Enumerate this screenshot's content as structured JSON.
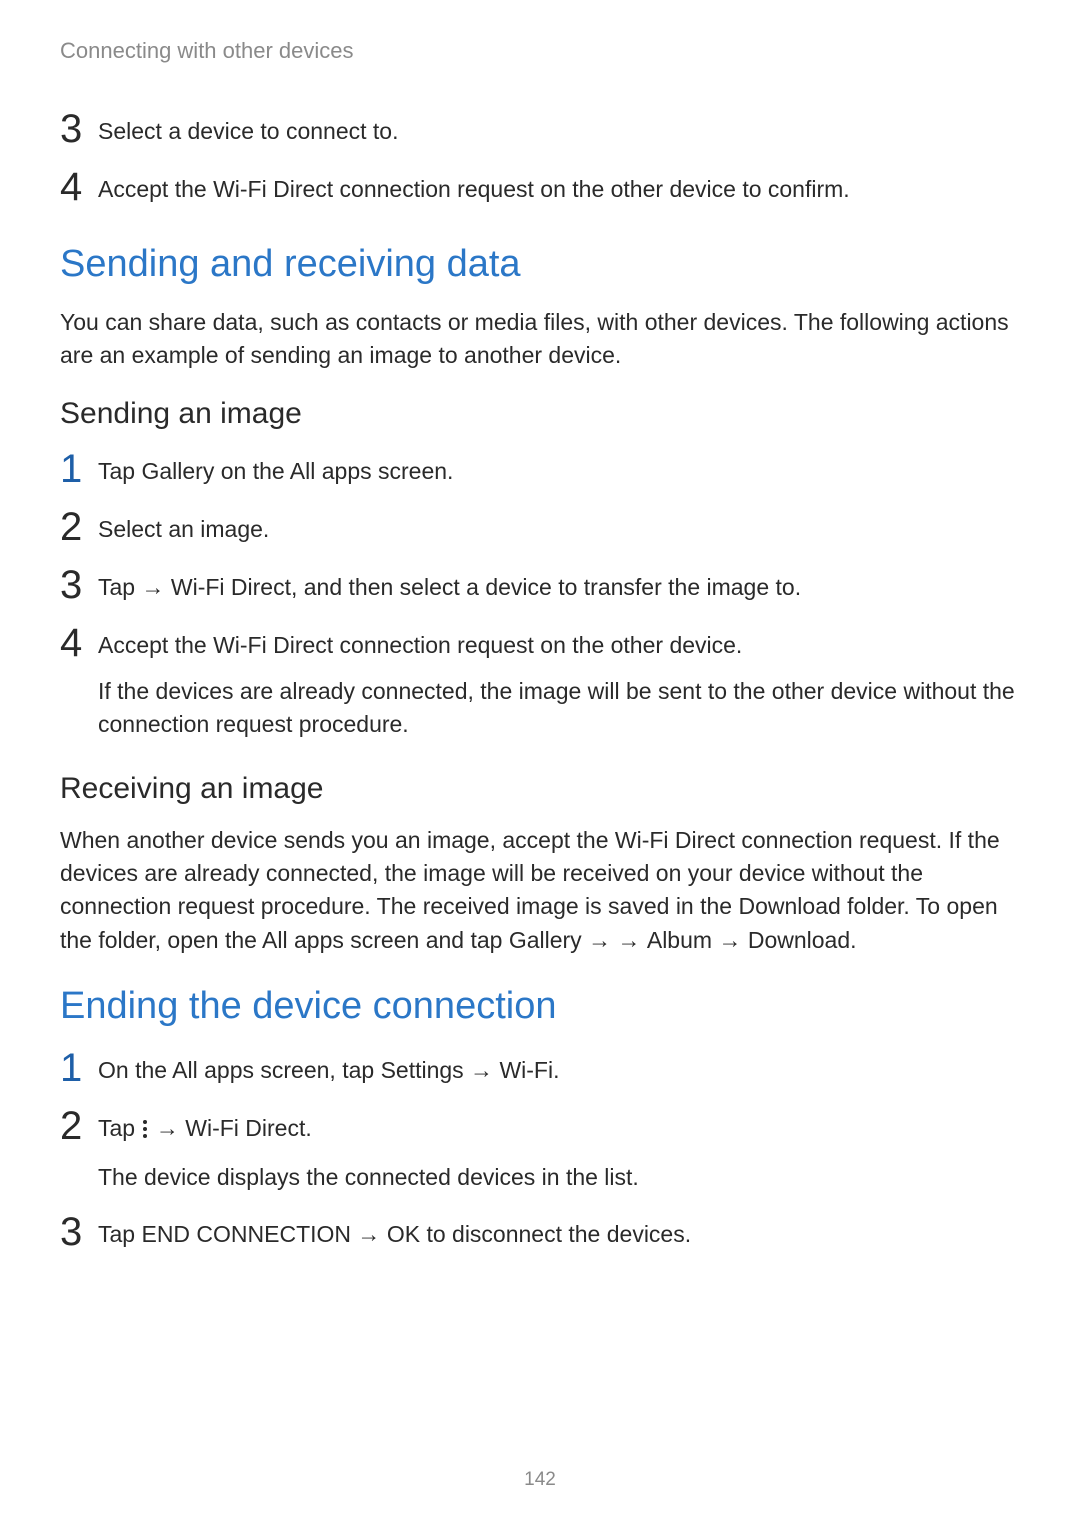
{
  "header": {
    "breadcrumb": "Connecting with other devices"
  },
  "intro_steps": {
    "s3": {
      "num": "3",
      "text": "Select a device to connect to."
    },
    "s4": {
      "num": "4",
      "text": "Accept the Wi-Fi Direct connection request on the other device to confirm."
    }
  },
  "section1": {
    "heading": "Sending and receiving data",
    "intro": "You can share data, such as contacts or media files, with other devices. The following actions are an example of sending an image to another device.",
    "sub1": {
      "heading": "Sending an image",
      "s1": {
        "num": "1",
        "pre": "Tap ",
        "bold": "Gallery",
        "post": " on the All apps screen."
      },
      "s2": {
        "num": "2",
        "text": "Select an image."
      },
      "s3": {
        "num": "3",
        "pre": "Tap ",
        "arrow1": " → ",
        "bold": "Wi-Fi Direct",
        "post": ", and then select a device to transfer the image to."
      },
      "s4": {
        "num": "4",
        "text": "Accept the Wi-Fi Direct connection request on the other device.",
        "sub": "If the devices are already connected, the image will be sent to the other device without the connection request procedure."
      }
    },
    "sub2": {
      "heading": "Receiving an image",
      "para_pre": "When another device sends you an image, accept the Wi-Fi Direct connection request. If the devices are already connected, the image will be received on your device without the connection request procedure. The received image is saved in the ",
      "b1": "Download",
      "mid1": " folder. To open the folder, open the All apps screen and tap ",
      "b2": "Gallery",
      "arrow1": " → ",
      "gap": "   ",
      "arrow2": " → ",
      "b3": "Album",
      "arrow3": " → ",
      "b4": "Download",
      "end": "."
    }
  },
  "section2": {
    "heading": "Ending the device connection",
    "s1": {
      "num": "1",
      "pre": "On the All apps screen, tap ",
      "b1": "Settings",
      "arrow": " → ",
      "b2": "Wi-Fi",
      "post": "."
    },
    "s2": {
      "num": "2",
      "pre": "Tap ",
      "arrow": " → ",
      "b1": "Wi-Fi Direct",
      "post": ".",
      "sub": "The device displays the connected devices in the list."
    },
    "s3": {
      "num": "3",
      "pre": "Tap ",
      "b1": "END CONNECTION",
      "arrow": " → ",
      "b2": "OK",
      "post": " to disconnect the devices."
    }
  },
  "page_number": "142"
}
